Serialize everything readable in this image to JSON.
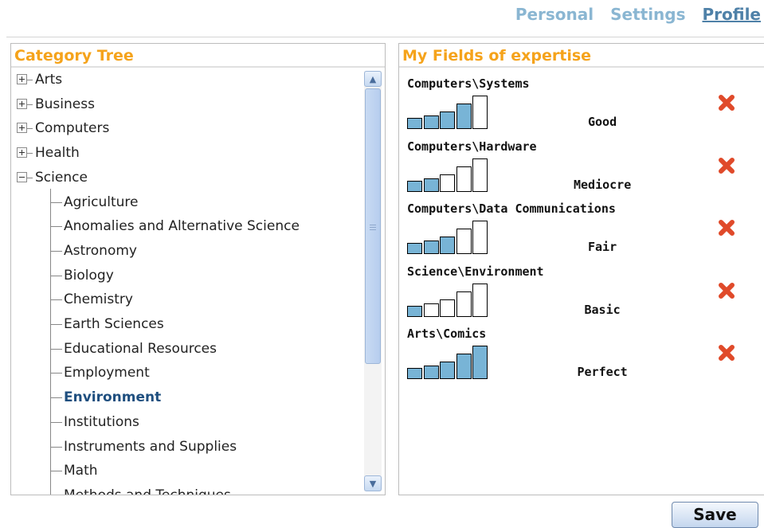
{
  "nav": {
    "items": [
      "Personal",
      "Settings",
      "Profile"
    ],
    "active": "Profile"
  },
  "category_tree": {
    "title": "Category Tree",
    "top_nodes": [
      {
        "label": "Arts",
        "expanded": false
      },
      {
        "label": "Business",
        "expanded": false
      },
      {
        "label": "Computers",
        "expanded": false
      },
      {
        "label": "Health",
        "expanded": false
      },
      {
        "label": "Science",
        "expanded": true
      }
    ],
    "science_children": [
      "Agriculture",
      "Anomalies and Alternative Science",
      "Astronomy",
      "Biology",
      "Chemistry",
      "Earth Sciences",
      "Educational Resources",
      "Employment",
      "Environment",
      "Institutions",
      "Instruments and Supplies",
      "Math",
      "Methods and Techniques"
    ],
    "selected": "Environment"
  },
  "expertise": {
    "title": "My Fields of expertise",
    "items": [
      {
        "path": "Computers\\Systems",
        "level": "Good",
        "filled": 4
      },
      {
        "path": "Computers\\Hardware",
        "level": "Mediocre",
        "filled": 2
      },
      {
        "path": "Computers\\Data Communications",
        "level": "Fair",
        "filled": 3
      },
      {
        "path": "Science\\Environment",
        "level": "Basic",
        "filled": 1
      },
      {
        "path": "Arts\\Comics",
        "level": "Perfect",
        "filled": 5
      }
    ],
    "remove_icon": "close-x-icon"
  },
  "save_label": "Save",
  "colors": {
    "title": "#f5a31b",
    "bar_fill": "#78b4d6",
    "nav": "#8ab6d2",
    "nav_active": "#4f81a8",
    "remove": "#e04a2a"
  }
}
